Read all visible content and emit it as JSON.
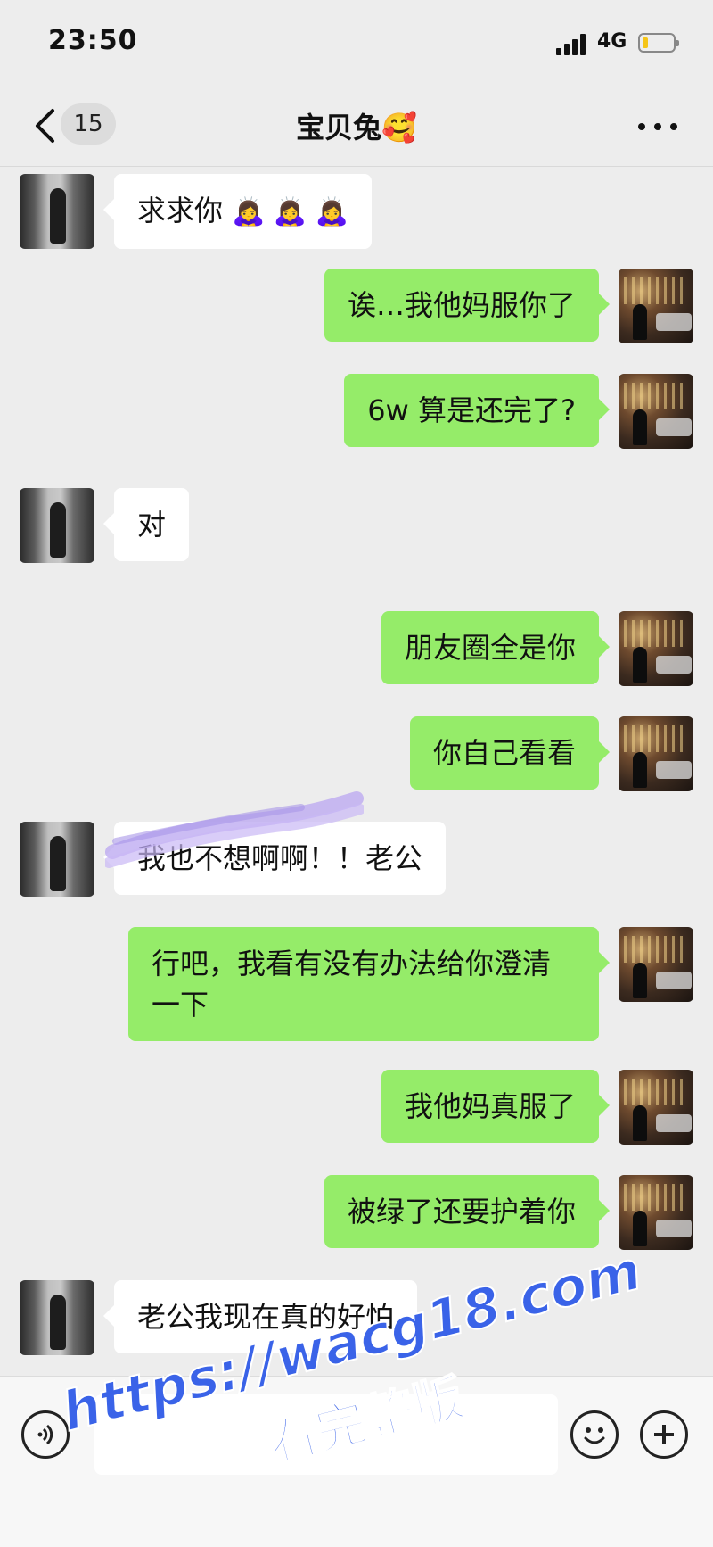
{
  "status_bar": {
    "time": "23:50",
    "network": "4G",
    "battery_level": 0.2
  },
  "nav": {
    "back_badge": "15",
    "title": "宝贝兔",
    "title_emoji": "🥰"
  },
  "messages": [
    {
      "side": "in",
      "text": "求求你",
      "emoji": "🙇‍♀️ 🙇‍♀️ 🙇‍♀️"
    },
    {
      "side": "out",
      "text": "诶…我他妈服你了"
    },
    {
      "side": "out",
      "text": "6w 算是还完了?"
    },
    {
      "side": "in",
      "text": "对"
    },
    {
      "side": "out",
      "text": "朋友圈全是你"
    },
    {
      "side": "out",
      "text": "你自己看看"
    },
    {
      "side": "in",
      "text": "我也不想啊啊！！老公"
    },
    {
      "side": "out",
      "text": "行吧，我看有没有办法给你澄清一下"
    },
    {
      "side": "out",
      "text": "我他妈真服了"
    },
    {
      "side": "out",
      "text": "被绿了还要护着你"
    },
    {
      "side": "in",
      "text": "老公我现在真的好怕"
    }
  ],
  "watermark": {
    "url": "https://wacg18.com",
    "subtitle": "看完整版"
  },
  "colors": {
    "incoming": "#ffffff",
    "outgoing": "#95ec69",
    "watermark": "#3a63e8"
  },
  "icons": {
    "back": "chevron-left-icon",
    "more": "more-dots-icon",
    "voice": "voice-icon",
    "emoji": "emoji-icon",
    "add": "plus-icon"
  }
}
